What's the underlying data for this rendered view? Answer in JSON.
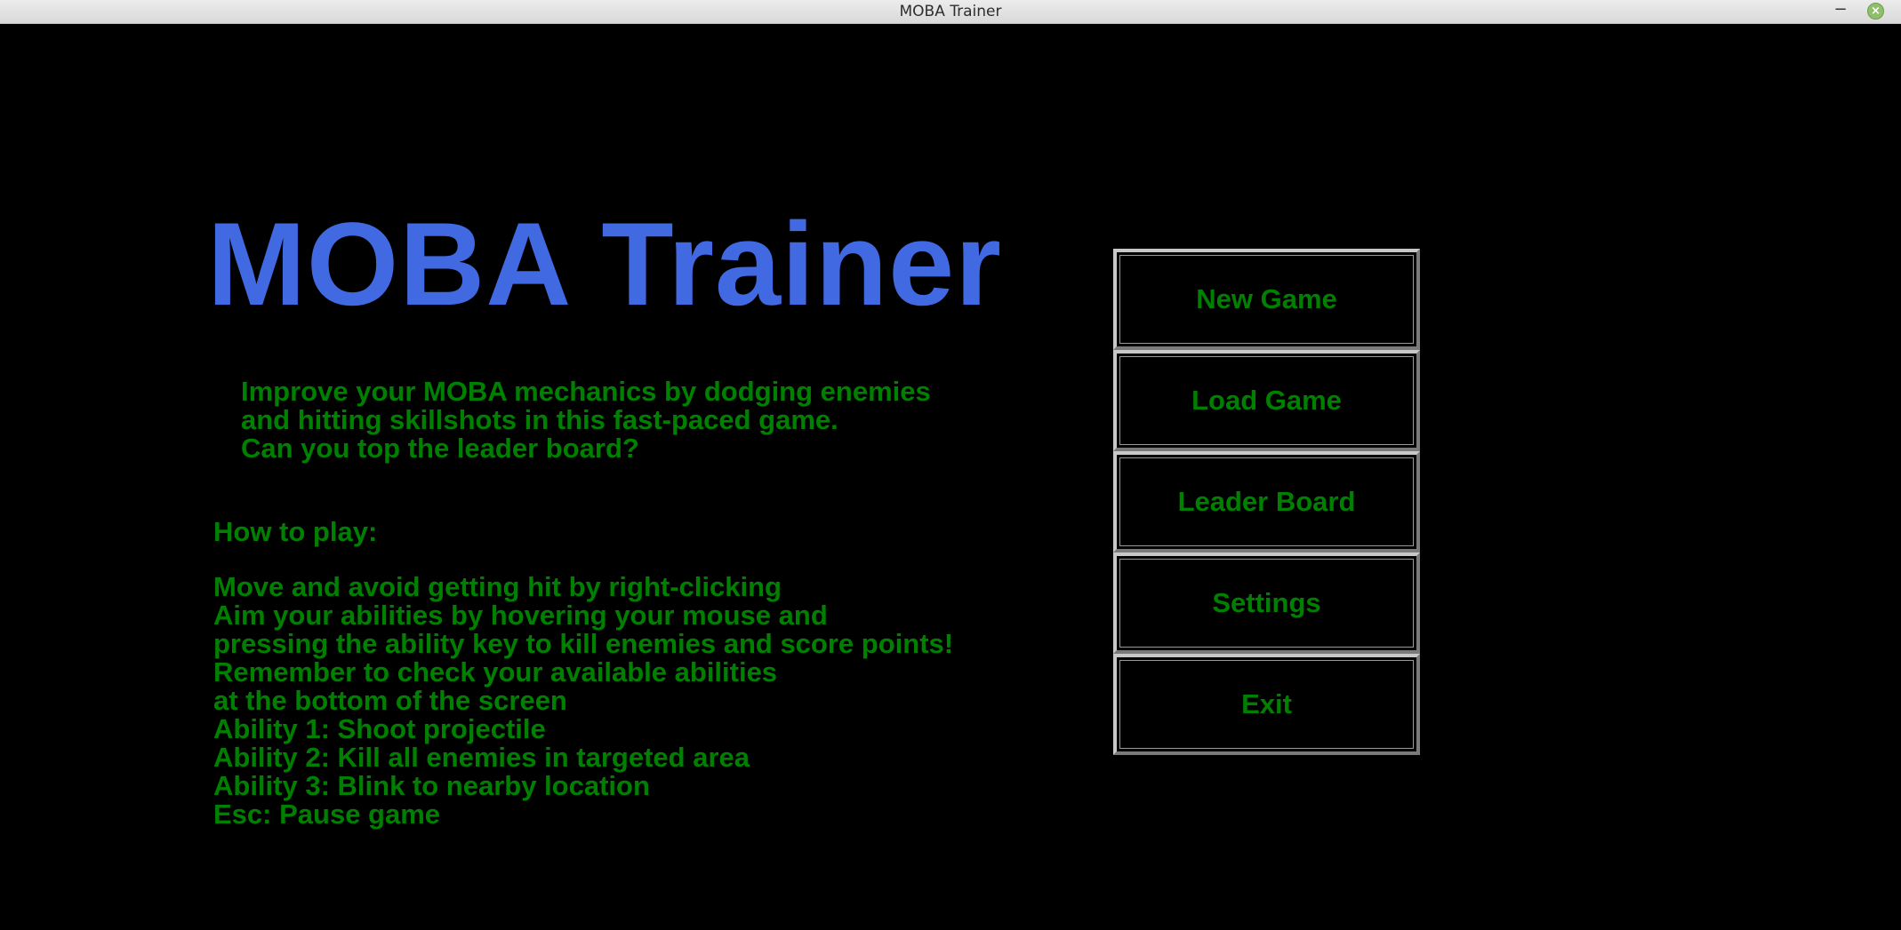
{
  "window": {
    "title": "MOBA Trainer",
    "minimize_label": "−",
    "close_label": "×"
  },
  "colors": {
    "background": "#000000",
    "title": "#4169e1",
    "text": "#008000"
  },
  "game": {
    "title": "MOBA Trainer",
    "intro": [
      "Improve your MOBA mechanics by dodging enemies",
      "and hitting skillshots in this fast-paced game.",
      "Can you top the leader board?"
    ],
    "howto_heading": "How to play:",
    "instructions": [
      "Move and avoid getting hit by right-clicking",
      "Aim your abilities by hovering your mouse and",
      "pressing the ability key to kill enemies and score points!",
      "Remember to check your available abilities",
      "at the bottom of the screen",
      "Ability 1: Shoot projectile",
      "Ability 2: Kill all enemies in targeted area",
      "Ability 3: Blink to nearby location",
      "Esc: Pause game"
    ]
  },
  "menu": {
    "buttons": [
      {
        "name": "new-game-button",
        "label": "New Game"
      },
      {
        "name": "load-game-button",
        "label": "Load Game"
      },
      {
        "name": "leader-board-button",
        "label": "Leader Board"
      },
      {
        "name": "settings-button",
        "label": "Settings"
      },
      {
        "name": "exit-button",
        "label": "Exit"
      }
    ]
  }
}
